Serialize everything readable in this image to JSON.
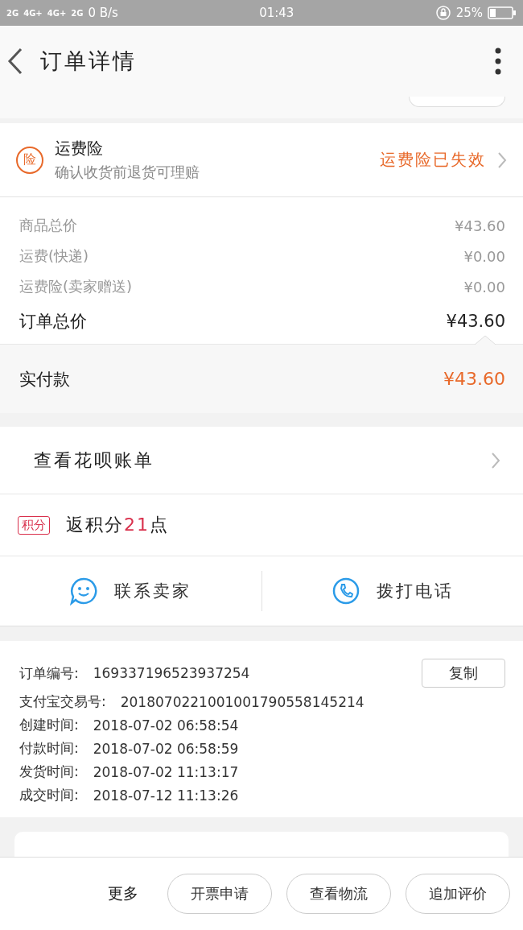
{
  "status_bar": {
    "network_labels": [
      "2G",
      "4G+",
      "4G+",
      "2G"
    ],
    "speed": "0 B/s",
    "time": "01:43",
    "battery": "25%"
  },
  "header": {
    "title": "订单详情"
  },
  "insurance": {
    "badge": "险",
    "title": "运费险",
    "subtitle": "确认收货前退货可理赔",
    "status": "运费险已失效"
  },
  "price_rows": [
    {
      "label": "商品总价",
      "value": "¥43.60",
      "kind": "minor"
    },
    {
      "label": "运费(快递)",
      "value": "¥0.00",
      "kind": "minor"
    },
    {
      "label": "运费险(卖家赠送)",
      "value": "¥0.00",
      "kind": "minor"
    },
    {
      "label": "订单总价",
      "value": "¥43.60",
      "kind": "total"
    }
  ],
  "payment": {
    "label": "实付款",
    "value": "¥43.60"
  },
  "huabei": {
    "label": "查看花呗账单"
  },
  "points": {
    "tag": "积分",
    "prefix": "返积分",
    "amount": "21",
    "suffix": "点"
  },
  "contact": [
    {
      "label": "联系卖家",
      "kind": "chat"
    },
    {
      "label": "拨打电话",
      "kind": "phone"
    }
  ],
  "order_info": {
    "copy_button": "复制",
    "rows": [
      {
        "label": "订单编号:",
        "value": "169337196523937254"
      },
      {
        "label": "支付宝交易号:",
        "value": "2018070221001001790558145214"
      },
      {
        "label": "创建时间:",
        "value": "2018-07-02 06:58:54"
      },
      {
        "label": "付款时间:",
        "value": "2018-07-02 06:58:59"
      },
      {
        "label": "发货时间:",
        "value": "2018-07-02 11:13:17"
      },
      {
        "label": "成交时间:",
        "value": "2018-07-12 11:13:26"
      }
    ]
  },
  "bottom_bar": {
    "more": "更多",
    "buttons": [
      "开票申请",
      "查看物流",
      "追加评价"
    ]
  }
}
